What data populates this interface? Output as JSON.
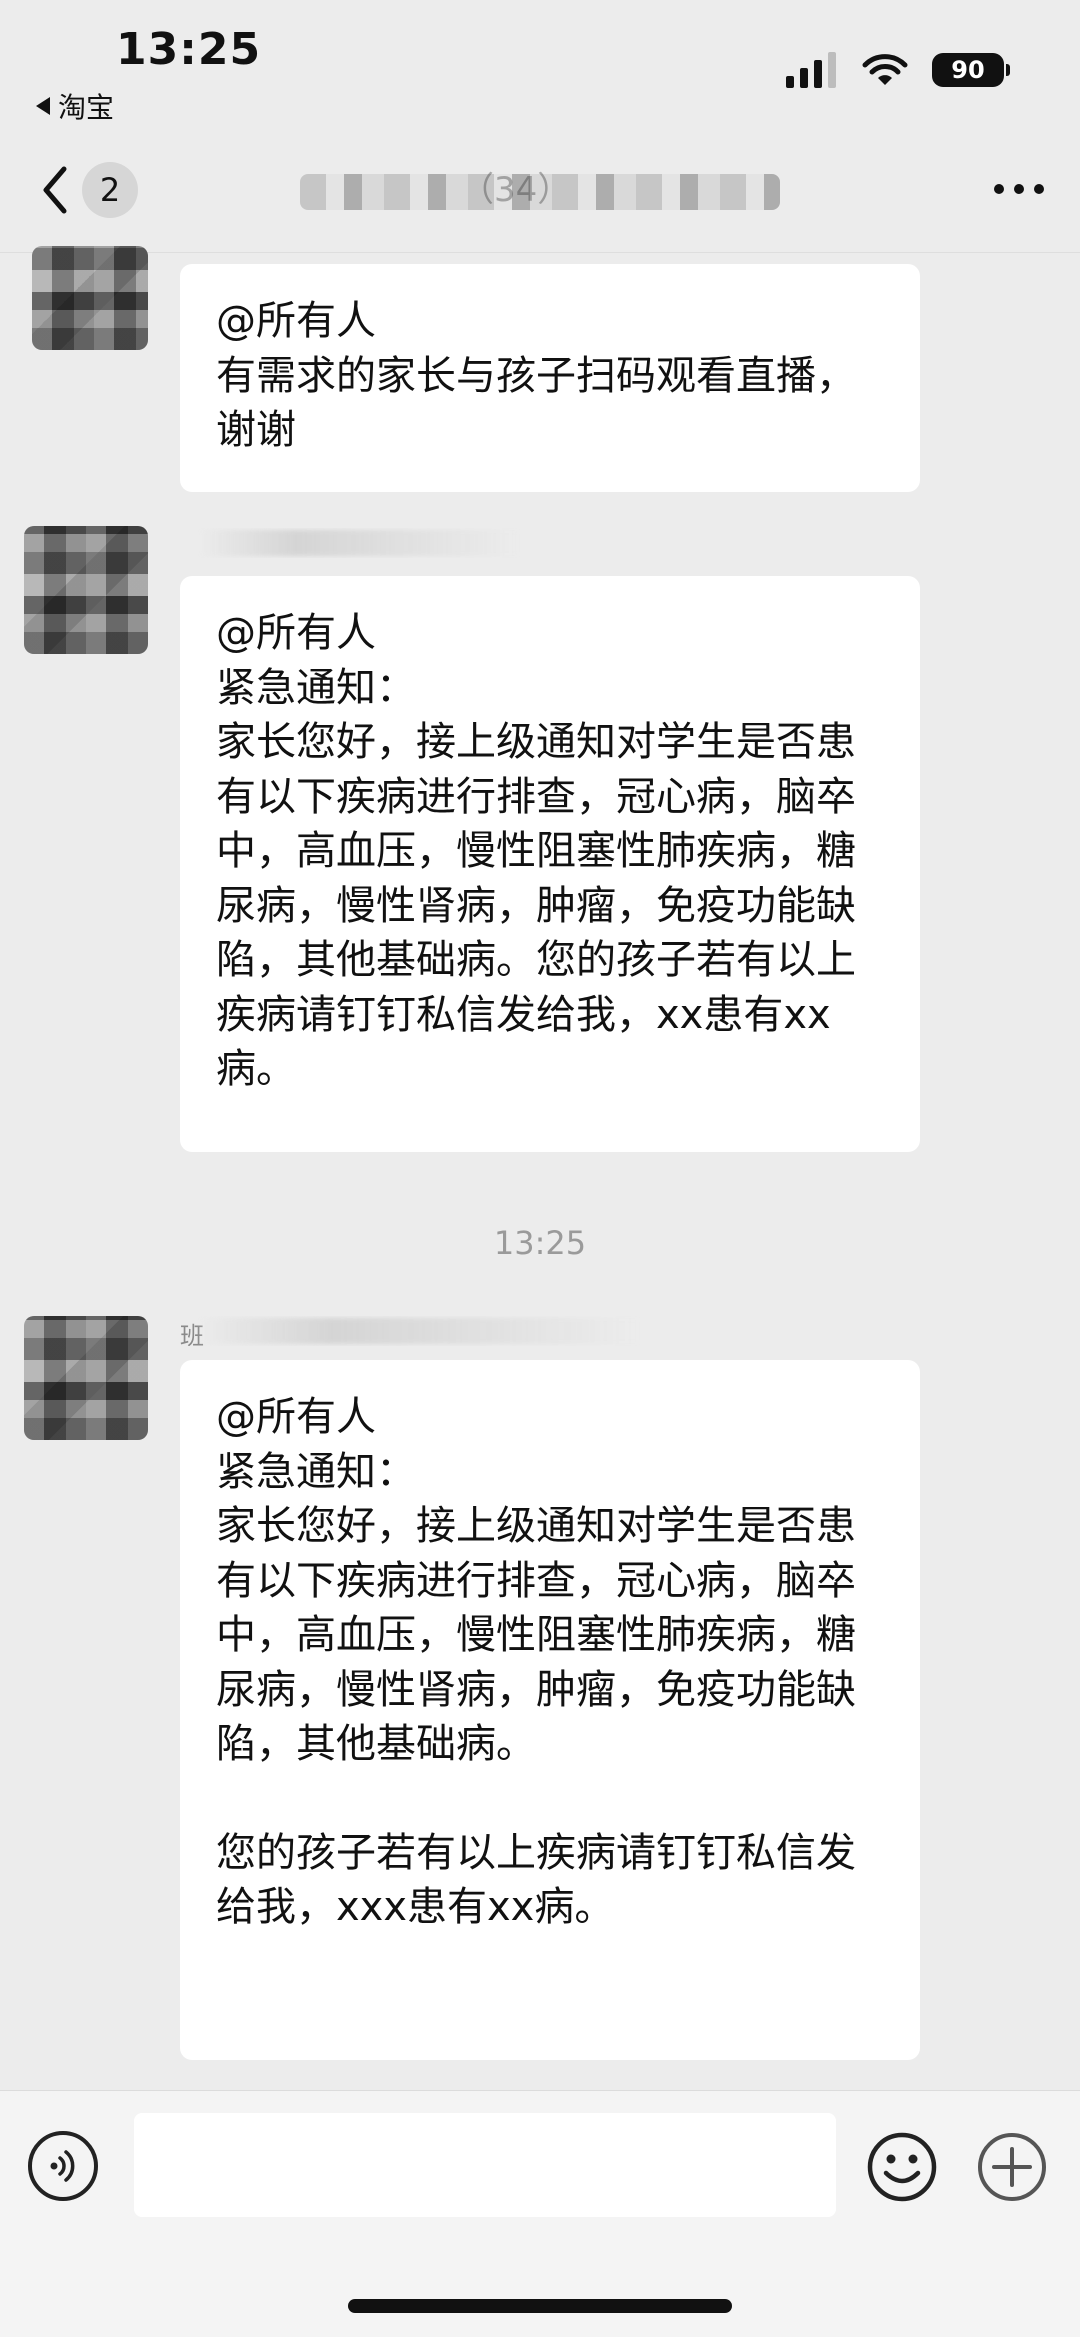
{
  "status_bar": {
    "time": "13:25",
    "back_app": "淘宝",
    "battery": "90"
  },
  "nav": {
    "unread_count": "2",
    "title": "（34）"
  },
  "messages": [
    {
      "sender": "",
      "lines": [
        "@所有人",
        "有需求的家长与孩子扫码观看直播，谢谢"
      ]
    },
    {
      "sender": "",
      "lines": [
        "@所有人",
        "紧急通知：",
        "家长您好，接上级通知对学生是否患有以下疾病进行排查，冠心病，脑卒中，高血压，慢性阻塞性肺疾病，糖尿病，慢性肾病，肿瘤，免疫功能缺陷，其他基础病。您的孩子若有以上疾病请钉钉私信发给我，xx患有xx病。"
      ]
    },
    {
      "sender": "班",
      "lines": [
        "@所有人",
        "紧急通知：",
        "家长您好，接上级通知对学生是否患有以下疾病进行排查，冠心病，脑卒中，高血压，慢性阻塞性肺疾病，糖尿病，慢性肾病，肿瘤，免疫功能缺陷，其他基础病。",
        "",
        "您的孩子若有以上疾病请钉钉私信发给我，xxx患有xx病。"
      ]
    }
  ],
  "time_divider": "13:25",
  "input": {
    "value": "",
    "placeholder": ""
  },
  "icons": {
    "back": "chevron-left-icon",
    "more": "more-dots-icon",
    "voice": "voice-icon",
    "emoji": "emoji-icon",
    "plus": "plus-icon",
    "signal": "signal-icon",
    "wifi": "wifi-icon",
    "battery": "battery-icon"
  }
}
